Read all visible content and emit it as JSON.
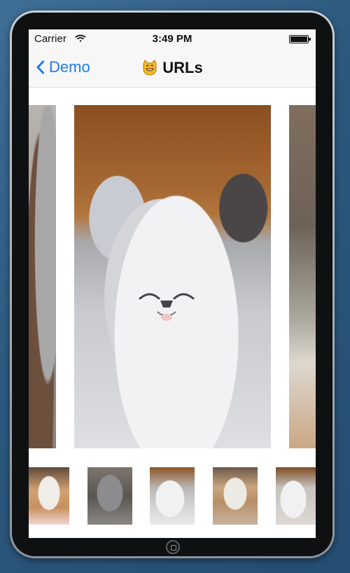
{
  "status_bar": {
    "carrier": "Carrier",
    "wifi_icon": "wifi-icon",
    "time": "3:49 PM",
    "battery_icon": "battery-icon"
  },
  "navigation_bar": {
    "back_label": "Demo",
    "back_icon": "chevron-left-icon",
    "title_emoji": "grinning-cat-icon",
    "title": "URLs",
    "tint": "#1a7cf7"
  },
  "gallery": {
    "pages": [
      {
        "name": "kitten-photo-left-partial",
        "icon": "image-icon"
      },
      {
        "name": "kitten-photo-current",
        "icon": "image-icon"
      },
      {
        "name": "kitten-photo-right-partial",
        "icon": "image-icon"
      }
    ],
    "thumbnails": [
      {
        "name": "thumbnail-1",
        "icon": "image-icon"
      },
      {
        "name": "thumbnail-2",
        "icon": "image-icon"
      },
      {
        "name": "thumbnail-3",
        "icon": "image-icon"
      },
      {
        "name": "thumbnail-4",
        "icon": "image-icon"
      },
      {
        "name": "thumbnail-5",
        "icon": "image-icon"
      }
    ]
  },
  "device": {
    "home_button_icon": "home-button-icon"
  }
}
